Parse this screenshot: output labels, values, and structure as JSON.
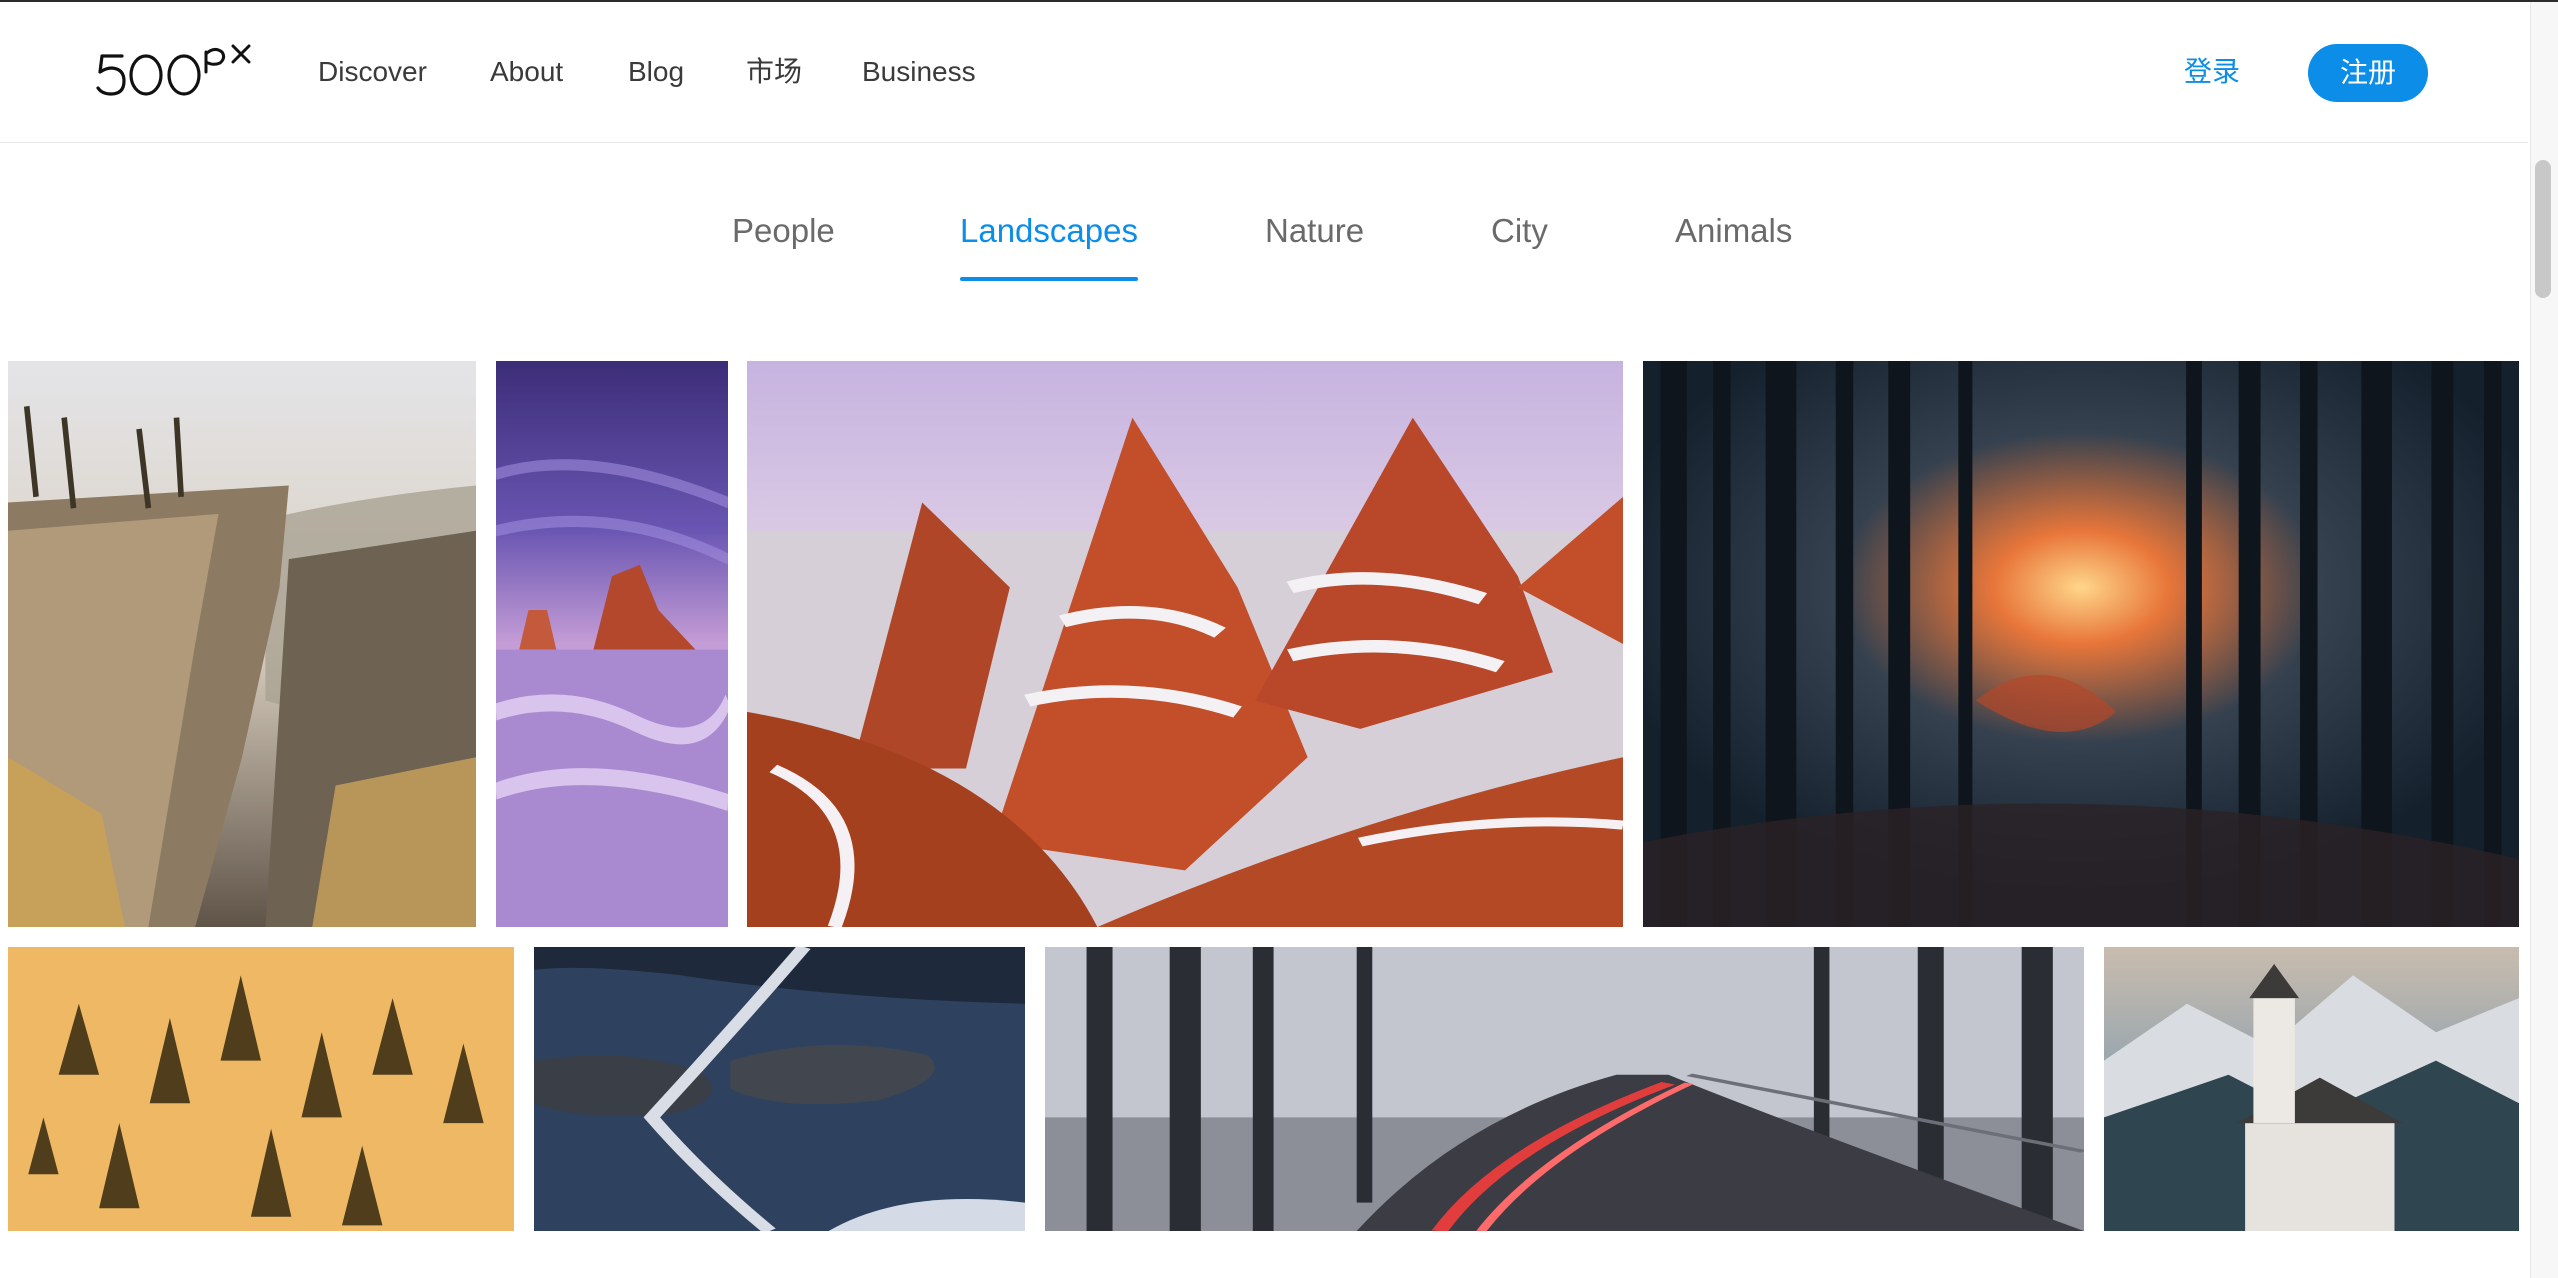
{
  "header": {
    "logo_text": "500px",
    "nav": [
      "Discover",
      "About",
      "Blog",
      "市场",
      "Business"
    ],
    "login": "登录",
    "signup": "注册"
  },
  "tabs": {
    "items": [
      "People",
      "Landscapes",
      "Nature",
      "City",
      "Animals"
    ],
    "active": "Landscapes"
  },
  "gallery": {
    "photos": [
      {
        "subject": "cliff-canyon"
      },
      {
        "subject": "sea-arch-purple-tidepool"
      },
      {
        "subject": "red-sandstone-snow"
      },
      {
        "subject": "dark-forest-sunlight"
      },
      {
        "subject": "golden-foggy-forest"
      },
      {
        "subject": "aerial-bridge-lake"
      },
      {
        "subject": "snowy-road-light-trail"
      },
      {
        "subject": "mountain-church"
      }
    ]
  },
  "colors": {
    "accent": "#0b8de8",
    "nav_text": "#3a3a3a",
    "tab_text": "#6a6a6a"
  }
}
